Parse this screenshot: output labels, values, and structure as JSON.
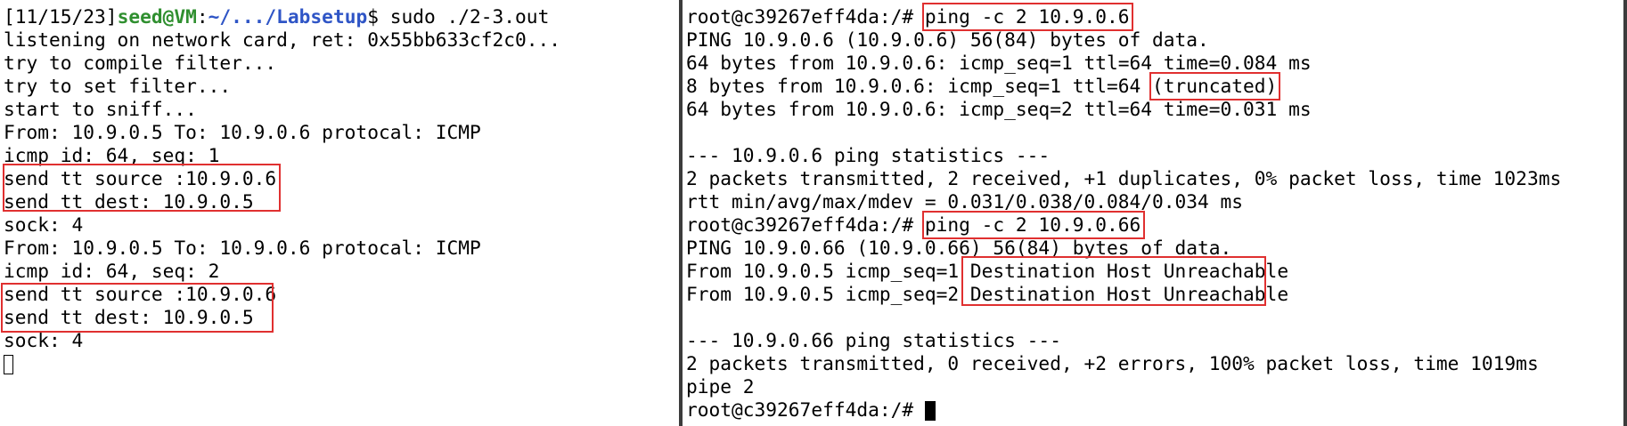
{
  "left_terminal": {
    "prompt_date": "[11/15/23]",
    "prompt_user": "seed@VM",
    "prompt_sep": ":",
    "prompt_path": "~/.../Labsetup",
    "prompt_symbol": "$",
    "command": " sudo ./2-3.out",
    "lines": [
      "listening on network card, ret: 0x55bb633cf2c0...",
      "try to compile filter...",
      "try to set filter...",
      "start to sniff...",
      "From: 10.9.0.5 To: 10.9.0.6 protocal: ICMP",
      "icmp id: 64, seq: 1",
      "send tt source :10.9.0.6",
      "send tt dest: 10.9.0.5",
      "sock: 4",
      "From: 10.9.0.5 To: 10.9.0.6 protocal: ICMP",
      "icmp id: 64, seq: 2",
      "send tt source :10.9.0.6",
      "send tt dest: 10.9.0.5",
      "sock: 4"
    ]
  },
  "right_terminal": {
    "prompt": "root@c39267eff4da:/# ",
    "cmd1": "ping -c 2 10.9.0.6",
    "ping1_header": "PING 10.9.0.6 (10.9.0.6) 56(84) bytes of data.",
    "ping1_reply1": "64 bytes from 10.9.0.6: icmp_seq=1 ttl=64 time=0.084 ms",
    "ping1_trunc_prefix": "8 bytes from 10.9.0.6: icmp_seq=1 ttl=64 ",
    "ping1_trunc_label": "(truncated)",
    "ping1_reply2": "64 bytes from 10.9.0.6: icmp_seq=2 ttl=64 time=0.031 ms",
    "blank1": "",
    "stats1_header": "--- 10.9.0.6 ping statistics ---",
    "stats1_summary": "2 packets transmitted, 2 received, +1 duplicates, 0% packet loss, time 1023ms",
    "stats1_rtt": "rtt min/avg/max/mdev = 0.031/0.038/0.084/0.034 ms",
    "cmd2": "ping -c 2 10.9.0.66",
    "ping2_header": "PING 10.9.0.66 (10.9.0.66) 56(84) bytes of data.",
    "unreach1_prefix": "From 10.9.0.5 icmp_seq=1 ",
    "unreach2_prefix": "From 10.9.0.5 icmp_seq=2 ",
    "unreach_msg": "Destination Host Unreachable",
    "blank2": "",
    "stats2_header": "--- 10.9.0.66 ping statistics ---",
    "stats2_summary": "2 packets transmitted, 0 received, +2 errors, 100% packet loss, time 1019ms",
    "pipe_line": "pipe 2"
  },
  "colors": {
    "prompt_user": "#2f8f2f",
    "prompt_path": "#2f55c6",
    "highlight_box": "#e03030",
    "divider": "#3c3c3c"
  }
}
